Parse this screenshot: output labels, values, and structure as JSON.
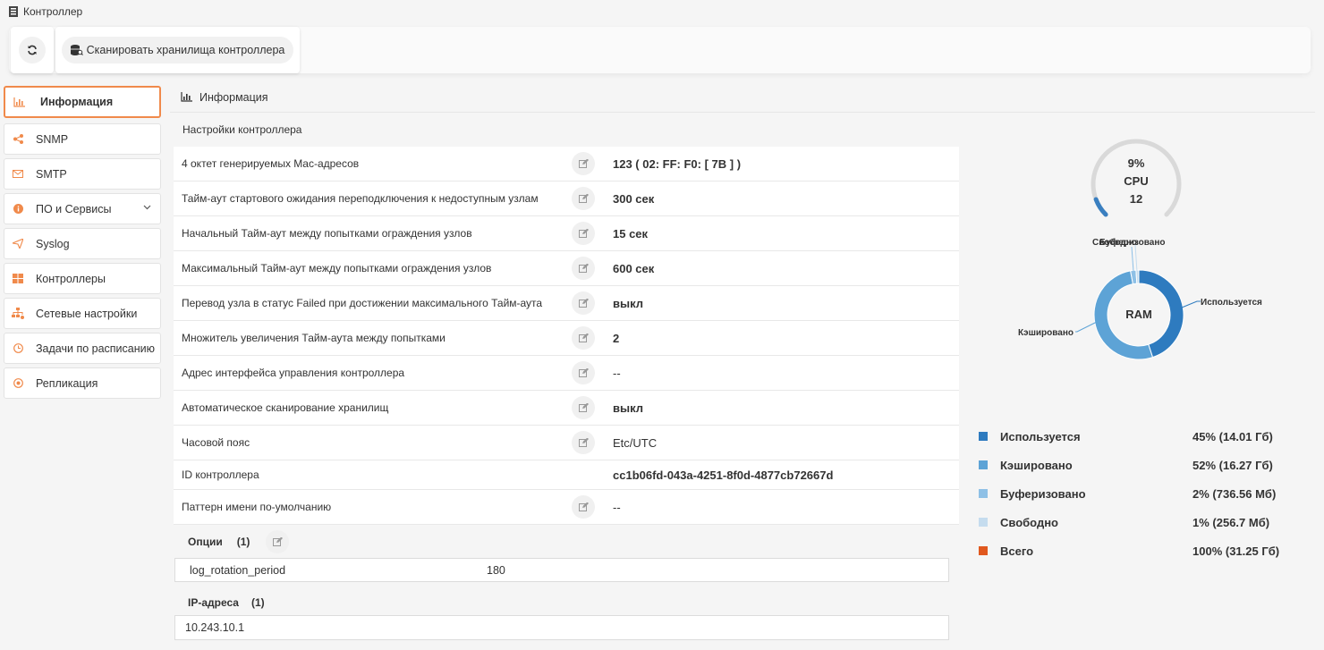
{
  "window": {
    "title": "Контроллер",
    "title_icon": "server-icon"
  },
  "toolbar": {
    "refresh_icon": "refresh-icon",
    "scan_label": "Сканировать хранилища контроллера",
    "scan_icon": "database-search-icon"
  },
  "sidebar": {
    "items": [
      {
        "label": "Информация",
        "icon": "bar-chart-icon",
        "active": true
      },
      {
        "label": "SNMP",
        "icon": "share-icon"
      },
      {
        "label": "SMTP",
        "icon": "envelope-icon"
      },
      {
        "label": "ПО и Сервисы",
        "icon": "info-circle-icon",
        "has_submenu": true
      },
      {
        "label": "Syslog",
        "icon": "paper-plane-icon"
      },
      {
        "label": "Контроллеры",
        "icon": "grid-icon"
      },
      {
        "label": "Сетевые настройки",
        "icon": "network-icon"
      },
      {
        "label": "Задачи по расписанию",
        "icon": "clock-icon"
      },
      {
        "label": "Репликация",
        "icon": "plus-circle-icon"
      }
    ],
    "accent_color": "#f08a4b"
  },
  "main": {
    "header": "Информация",
    "subheader": "Настройки контроллера",
    "settings": [
      {
        "label": "4 октет генерируемых Mac-адресов",
        "value": "123 ( 02: FF: F0: [ 7B ] )",
        "editable": true
      },
      {
        "label": "Тайм-аут стартового ожидания переподключения к недоступным узлам",
        "value": "300 сек",
        "editable": true
      },
      {
        "label": "Начальный Тайм-аут между попытками ограждения узлов",
        "value": "15 сек",
        "editable": true
      },
      {
        "label": "Максимальный Тайм-аут между попытками ограждения узлов",
        "value": "600 сек",
        "editable": true
      },
      {
        "label": "Перевод узла в статус Failed при достижении максимального Тайм-аута",
        "value": "выкл",
        "editable": true
      },
      {
        "label": "Множитель увеличения Тайм-аута между попытками",
        "value": "2",
        "editable": true
      },
      {
        "label": "Адрес интерфейса управления контроллера",
        "value": "--",
        "editable": true,
        "plain": true
      },
      {
        "label": "Автоматическое сканирование хранилищ",
        "value": "выкл",
        "editable": true
      },
      {
        "label": "Часовой пояс",
        "value": "Etc/UTC",
        "editable": true,
        "plain": true
      },
      {
        "label": "ID контроллера",
        "value": "cc1b06fd-043a-4251-8f0d-4877cb72667d",
        "editable": false
      },
      {
        "label": "Паттерн имени по-умолчанию",
        "value": "--",
        "editable": true,
        "plain": true
      }
    ],
    "options": {
      "title": "Опции",
      "count": "(1)",
      "rows": [
        {
          "key": "log_rotation_period",
          "value": "180"
        }
      ]
    },
    "ip": {
      "title": "IP-адреса",
      "count": "(1)",
      "rows": [
        "10.243.10.1"
      ]
    }
  },
  "cpu": {
    "percent_label": "9%",
    "name": "CPU",
    "cores": "12",
    "percent": 9,
    "color": "#3a7fc0",
    "track_color": "#d9d9d9"
  },
  "ram": {
    "center_label": "RAM",
    "slices": [
      {
        "name": "Используется",
        "value": "45% (14.01 Гб)",
        "percent": 45,
        "color": "#2e7bbf"
      },
      {
        "name": "Кэшировано",
        "value": "52% (16.27 Гб)",
        "percent": 52,
        "color": "#5da3d6"
      },
      {
        "name": "Буферизовано",
        "value": "2% (736.56 Мб)",
        "percent": 2,
        "color": "#8ec0e6"
      },
      {
        "name": "Свободно",
        "value": "1% (256.7 Мб)",
        "percent": 1,
        "color": "#c5dcee"
      }
    ],
    "total": {
      "name": "Всего",
      "value": "100% (31.25 Гб)",
      "color": "#e0581e"
    }
  },
  "chart_data": {
    "type": "pie",
    "title": "RAM",
    "categories": [
      "Используется",
      "Кэшировано",
      "Буферизовано",
      "Свободно"
    ],
    "values": [
      45,
      52,
      2,
      1
    ]
  }
}
